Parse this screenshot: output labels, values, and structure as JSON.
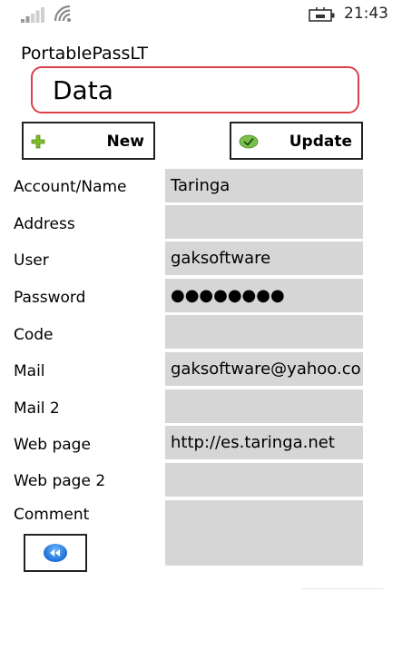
{
  "status": {
    "time": "21:43"
  },
  "app": {
    "title": "PortablePassLT",
    "header": "Data"
  },
  "toolbar": {
    "new_label": "New",
    "update_label": "Update"
  },
  "form": {
    "fields": [
      {
        "label": "Account/Name",
        "value": "Taringa"
      },
      {
        "label": "Address",
        "value": ""
      },
      {
        "label": "User",
        "value": "gaksoftware"
      },
      {
        "label": "Password",
        "value": "●●●●●●●●"
      },
      {
        "label": "Code",
        "value": ""
      },
      {
        "label": "Mail",
        "value": "gaksoftware@yahoo.co"
      },
      {
        "label": "Mail 2",
        "value": ""
      },
      {
        "label": "Web page",
        "value": "http://es.taringa.net"
      },
      {
        "label": "Web page 2",
        "value": ""
      },
      {
        "label": "Comment",
        "value": ""
      }
    ]
  },
  "icons": {
    "new": "plus-icon",
    "update": "check-icon",
    "back": "rewind-icon",
    "signal": "signal-icon",
    "wifi": "wifi-icon",
    "battery": "battery-charging-icon"
  },
  "colors": {
    "header_border": "#d9424a",
    "field_bg": "#d6d6d6",
    "plus": "#7dbb2a",
    "check": "#7cc04a"
  }
}
